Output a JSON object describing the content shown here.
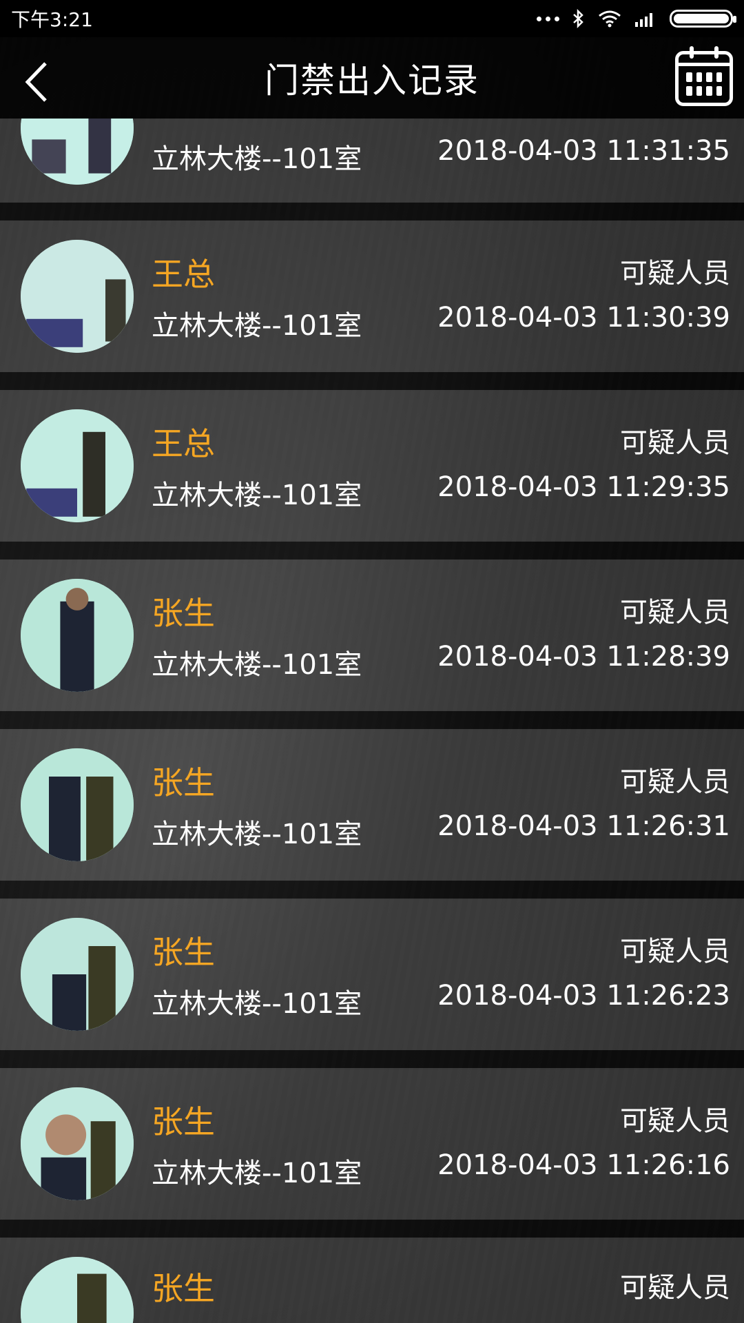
{
  "status_bar": {
    "time": "下午3:21",
    "icons": [
      "more-dots-icon",
      "bluetooth-icon",
      "wifi-icon",
      "signal-icon",
      "battery-icon"
    ]
  },
  "header": {
    "title": "门禁出入记录",
    "back_icon": "chevron-left-icon",
    "calendar_icon": "calendar-icon"
  },
  "colors": {
    "name": "#f5a623",
    "text": "#ffffff",
    "header_bg": "#000000"
  },
  "records": [
    {
      "name": "",
      "type": "",
      "place": "立林大楼--101室",
      "time": "2018-04-03 11:31:35"
    },
    {
      "name": "王总",
      "type": "可疑人员",
      "place": "立林大楼--101室",
      "time": "2018-04-03 11:30:39"
    },
    {
      "name": "王总",
      "type": "可疑人员",
      "place": "立林大楼--101室",
      "time": "2018-04-03 11:29:35"
    },
    {
      "name": "张生",
      "type": "可疑人员",
      "place": "立林大楼--101室",
      "time": "2018-04-03 11:28:39"
    },
    {
      "name": "张生",
      "type": "可疑人员",
      "place": "立林大楼--101室",
      "time": "2018-04-03 11:26:31"
    },
    {
      "name": "张生",
      "type": "可疑人员",
      "place": "立林大楼--101室",
      "time": "2018-04-03 11:26:23"
    },
    {
      "name": "张生",
      "type": "可疑人员",
      "place": "立林大楼--101室",
      "time": "2018-04-03 11:26:16"
    },
    {
      "name": "张生",
      "type": "可疑人员",
      "place": "",
      "time": ""
    }
  ]
}
